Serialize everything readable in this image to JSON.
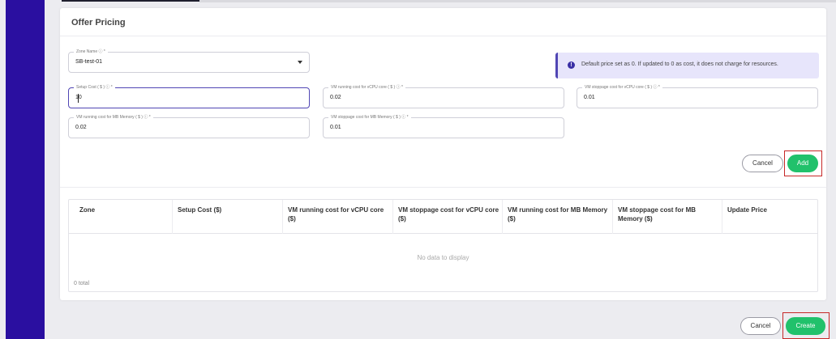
{
  "section_title": "Offer Pricing",
  "zone": {
    "label": "Zone Name ⓘ *",
    "value": "SB-test-01"
  },
  "info": {
    "icon": "info-icon",
    "text": "Default price set as 0. If updated to 0 as cost, it does not charge for resources."
  },
  "fields": {
    "setup_cost": {
      "label": "Setup Cost ( $ ) ⓘ *",
      "value": "10"
    },
    "vm_running_vcpu": {
      "label": "VM running cost for vCPU core ( $ ) ⓘ *",
      "value": "0.02"
    },
    "vm_stoppage_vcpu": {
      "label": "VM stoppage cost for vCPU core ( $ ) ⓘ *",
      "value": "0.01"
    },
    "vm_running_memory": {
      "label": "VM running cost for MB Memory ( $ ) ⓘ *",
      "value": "0.02"
    },
    "vm_stoppage_memory": {
      "label": "VM stoppage cost for MB Memory ( $ ) ⓘ *",
      "value": "0.01"
    }
  },
  "form_actions": {
    "cancel": "Cancel",
    "add": "Add"
  },
  "table": {
    "columns": [
      "Zone",
      "Setup Cost ($)",
      "VM running cost for vCPU core ($)",
      "VM stoppage cost for vCPU core ($)",
      "VM running cost for MB Memory ($)",
      "VM stoppage cost for MB Memory ($)",
      "Update Price"
    ],
    "empty_text": "No data to display",
    "total_text": "0 total"
  },
  "page_actions": {
    "cancel": "Cancel",
    "create": "Create"
  },
  "colors": {
    "sidebar": "#2a0fa0",
    "accent": "#5046b4",
    "green": "#21c16b",
    "highlight": "#c62828"
  }
}
